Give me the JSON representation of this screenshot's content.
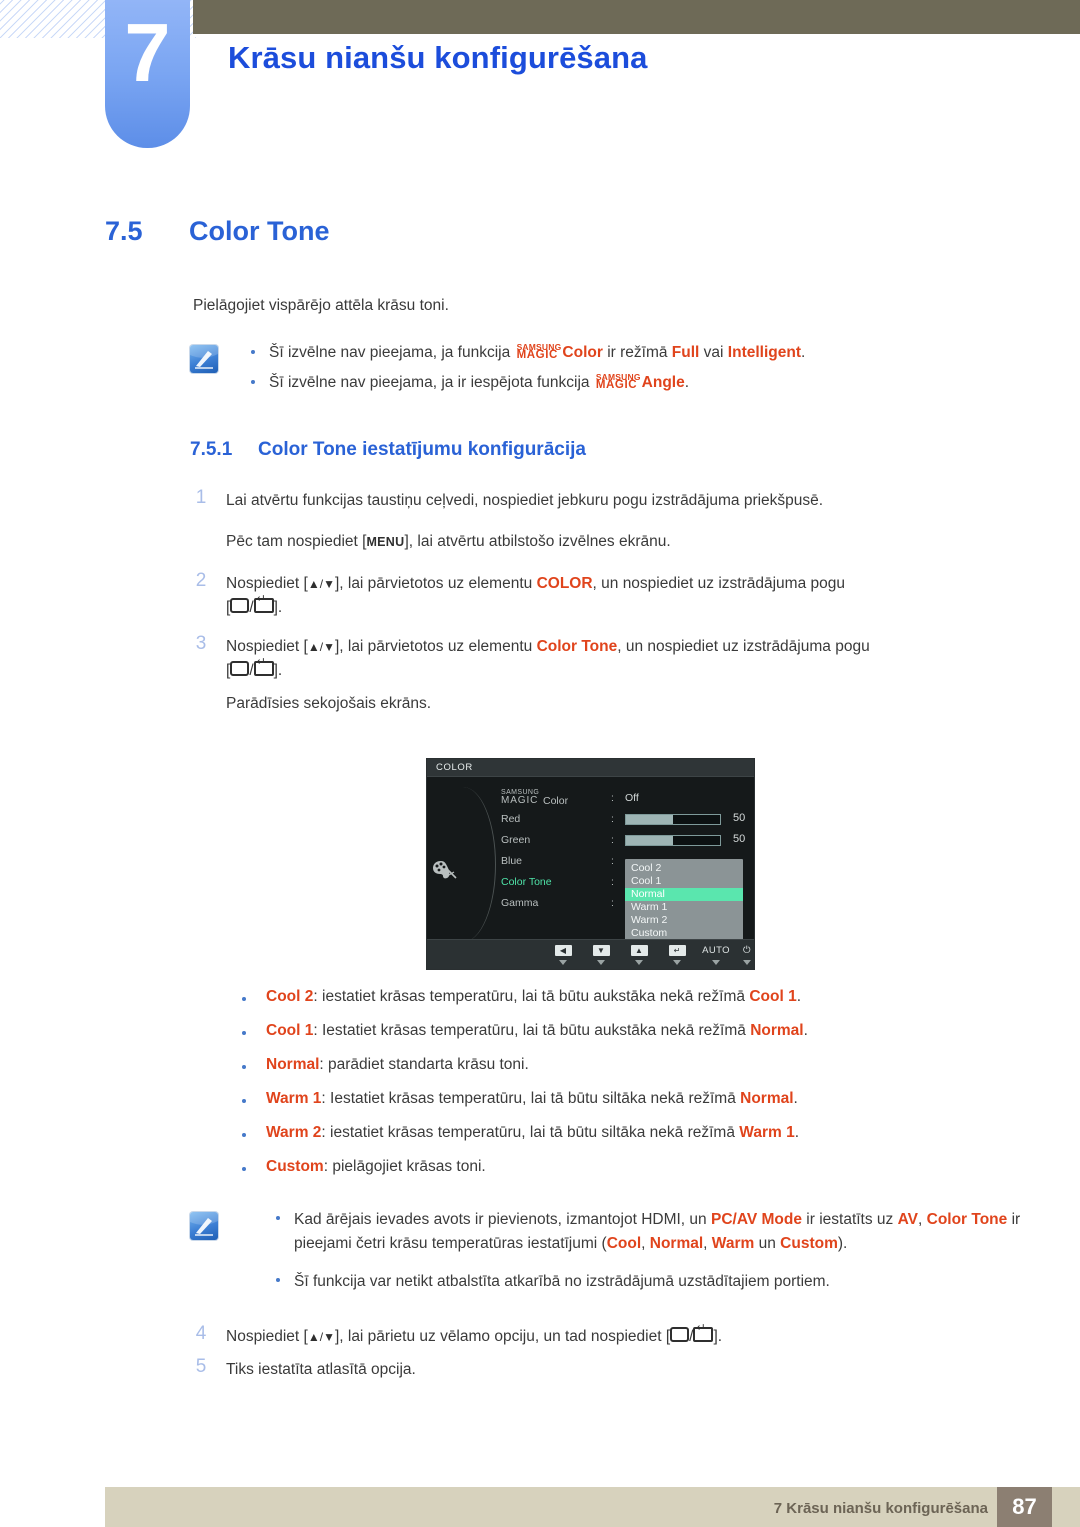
{
  "chapter": {
    "number": "7",
    "title": "Krāsu nianšu konfigurēšana"
  },
  "section": {
    "number": "7.5",
    "title": "Color Tone",
    "intro": "Pielāgojiet vispārējo attēla krāsu toni."
  },
  "note_top": {
    "bullets": [
      {
        "pre": "Šī izvēlne nav pieejama, ja funkcija ",
        "magic_top": "SAMSUNG",
        "magic_bottom": "MAGIC",
        "magic_suffix": "Color",
        "mid": " ir režīmā ",
        "bold1": "Full",
        "mid2": " vai ",
        "bold2": "Intelligent",
        "end": "."
      },
      {
        "pre": "Šī izvēlne nav pieejama, ja ir iespējota funkcija ",
        "magic_top": "SAMSUNG",
        "magic_bottom": "MAGIC",
        "magic_suffix": "Angle",
        "end": "."
      }
    ]
  },
  "subsection": {
    "number": "7.5.1",
    "title": "Color Tone iestatījumu konfigurācija"
  },
  "steps": {
    "s1_num": "1",
    "s1_text": "Lai atvērtu funkcijas taustiņu ceļvedi, nospiediet jebkuru pogu izstrādājuma priekšpusē.",
    "s1b_pre": "Pēc tam nospiediet [",
    "s1b_key": "MENU",
    "s1b_post": "], lai atvērtu atbilstošo izvēlnes ekrānu.",
    "s2_num": "2",
    "s2_pre": "Nospiediet [",
    "s2_arrows": "▲/▼",
    "s2_mid": "], lai pārvietotos uz elementu ",
    "s2_target": "COLOR",
    "s2_post": ", un nospiediet uz izstrādājuma pogu",
    "s3_num": "3",
    "s3_pre": "Nospiediet [",
    "s3_arrows": "▲/▼",
    "s3_mid": "], lai pārvietotos uz elementu ",
    "s3_target": "Color Tone",
    "s3_post": ", un nospiediet uz izstrādājuma pogu",
    "s3b_text": "Parādīsies sekojošais ekrāns.",
    "s4_num": "4",
    "s4_pre": "Nospiediet [",
    "s4_arrows": "▲/▼",
    "s4_mid": "], lai pārietu uz vēlamo opciju, un tad nospiediet [",
    "s4_post": "].",
    "s5_num": "5",
    "s5_text": "Tiks iestatīta atlasītā opcija."
  },
  "osd": {
    "title": "COLOR",
    "magic_top": "SAMSUNG",
    "magic_bottom": "MAGIC",
    "magic_suffix": "Color",
    "magic_value": "Off",
    "rows": [
      {
        "label": "Red",
        "value": "50",
        "type": "bar",
        "fill": 50
      },
      {
        "label": "Green",
        "value": "50",
        "type": "bar",
        "fill": 50
      },
      {
        "label": "Blue",
        "value": "",
        "type": "none"
      },
      {
        "label": "Color Tone",
        "value": "",
        "type": "none",
        "selected": true
      },
      {
        "label": "Gamma",
        "value": "",
        "type": "none"
      }
    ],
    "dropdown": {
      "items": [
        "Cool 2",
        "Cool 1",
        "Normal",
        "Warm 1",
        "Warm 2",
        "Custom"
      ],
      "highlighted": "Normal",
      "highlight_color": "#5ae6ae"
    },
    "footer_buttons": [
      {
        "name": "left",
        "glyph": "◀"
      },
      {
        "name": "down",
        "glyph": "▼"
      },
      {
        "name": "up",
        "glyph": "▲"
      },
      {
        "name": "enter",
        "glyph": "↵"
      },
      {
        "name": "auto",
        "glyph": "AUTO"
      },
      {
        "name": "power",
        "glyph": "⏻"
      }
    ],
    "colon": ":"
  },
  "options": [
    {
      "term": "Cool 2",
      "sep": ": ",
      "text_before": "iestatiet krāsas temperatūru, lai tā būtu aukstāka nekā režīmā ",
      "ref": "Cool 1",
      "text_after": "."
    },
    {
      "term": "Cool 1",
      "sep": ": ",
      "text_before": "Iestatiet krāsas temperatūru, lai tā būtu aukstāka nekā režīmā ",
      "ref": "Normal",
      "text_after": "."
    },
    {
      "term": "Normal",
      "sep": ": ",
      "text_before": "parādiet standarta krāsu toni.",
      "ref": "",
      "text_after": ""
    },
    {
      "term": "Warm 1",
      "sep": ": ",
      "text_before": "Iestatiet krāsas temperatūru, lai tā būtu siltāka nekā režīmā ",
      "ref": "Normal",
      "text_after": "."
    },
    {
      "term": "Warm 2",
      "sep": ": ",
      "text_before": "iestatiet krāsas temperatūru, lai tā būtu siltāka nekā režīmā ",
      "ref": "Warm 1",
      "text_after": "."
    },
    {
      "term": "Custom",
      "sep": ": ",
      "text_before": "pielāgojiet krāsas toni.",
      "ref": "",
      "text_after": ""
    }
  ],
  "note_bottom": {
    "b1_p1": "Kad ārējais ievades avots ir pievienots, izmantojot HDMI, un ",
    "b1_bold1": "PC/AV Mode",
    "b1_p2": " ir iestatīts uz ",
    "b1_bold2": "AV",
    "b1_p3": ", ",
    "b1_bold3": "Color Tone",
    "b1_p4": " ir pieejami četri krāsu temperatūras iestatījumi (",
    "b1_bold4": "Cool",
    "b1_p5": ", ",
    "b1_bold5": "Normal",
    "b1_p6": ", ",
    "b1_bold6": "Warm",
    "b1_p7": " un ",
    "b1_bold7": "Custom",
    "b1_p8": ").",
    "b2": "Šī funkcija var netikt atbalstīta atkarībā no izstrādājumā uzstādītajiem portiem."
  },
  "footer": {
    "text": "7 Krāsu nianšu konfigurēšana",
    "page": "87"
  },
  "colors": {
    "accent_blue": "#1c4ddb",
    "heading_blue": "#2a62d6",
    "orange": "#e0441c",
    "header_olive": "#6e6a57",
    "footer_tan": "#d7d2bd",
    "footer_page_brown": "#8c7f72",
    "tab_blue": "#7aa5f2"
  }
}
